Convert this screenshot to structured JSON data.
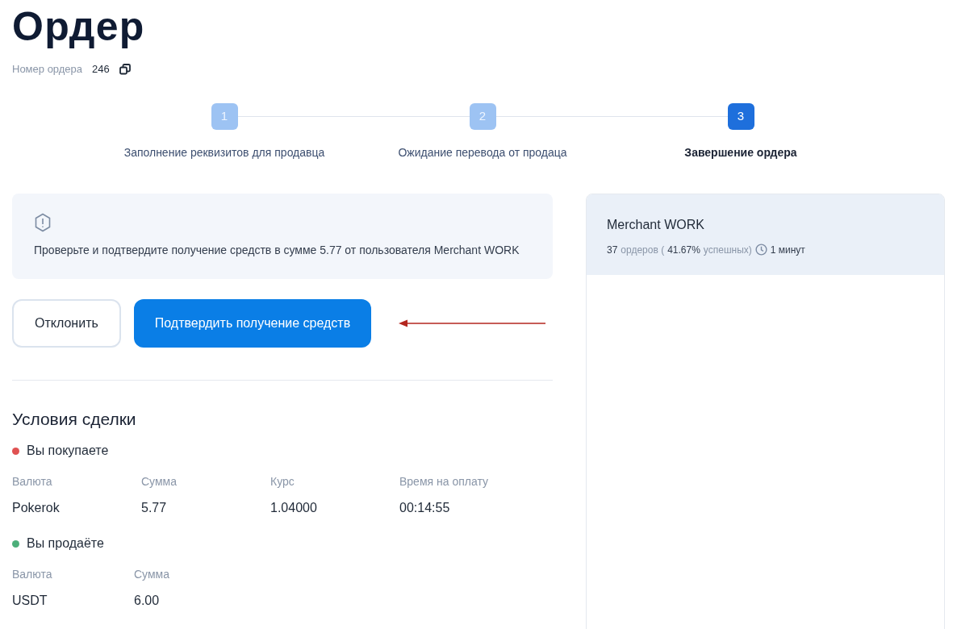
{
  "title": "Ордер",
  "order_number": {
    "label": "Номер ордера",
    "value": "246"
  },
  "steps": [
    {
      "number": "1",
      "label": "Заполнение реквизитов для продавца",
      "selected": false
    },
    {
      "number": "2",
      "label": "Ожидание перевода от продаца",
      "selected": false
    },
    {
      "number": "3",
      "label": "Завершение ордера",
      "selected": true
    }
  ],
  "notice": {
    "text": "Проверьте и подтвердите получение средств в сумме 5.77 от пользователя Merchant WORK"
  },
  "buttons": [
    {
      "label": "Отклонить",
      "kind": "outline"
    },
    {
      "label": "Подтвердить получение средств",
      "kind": "primary"
    }
  ],
  "deal": {
    "title": "Условия сделки",
    "sections": [
      {
        "label": "Вы покупаете",
        "color": "#e05252",
        "fields": [
          {
            "label": "Валюта",
            "value": "Pokerok"
          },
          {
            "label": "Сумма",
            "value": "5.77"
          },
          {
            "label": "Курс",
            "value": "1.04000"
          },
          {
            "label": "Время на оплату",
            "value": "00:14:55"
          }
        ]
      },
      {
        "label": "Вы продаёте",
        "color": "#4caf7a",
        "fields": [
          {
            "label": "Валюта",
            "value": "USDT"
          },
          {
            "label": "Сумма",
            "value": "6.00"
          }
        ]
      }
    ]
  },
  "merchant": {
    "name": "Merchant WORK",
    "stats": [
      {
        "text": "37",
        "kind": "value"
      },
      {
        "text": "ордеров (",
        "kind": "label"
      },
      {
        "text": "41.67%",
        "kind": "value"
      },
      {
        "text": "успешных)",
        "kind": "label"
      }
    ],
    "time": "1 минут"
  }
}
